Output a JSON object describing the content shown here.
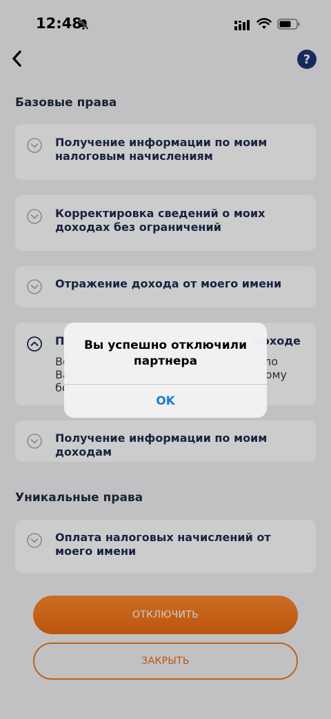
{
  "status_bar": {
    "time": "12:48"
  },
  "nav": {
    "help_label": "?"
  },
  "sections": {
    "basic": {
      "title": "Базовые права",
      "items": [
        {
          "title": "Получение информации по моим налоговым начислениям",
          "expanded": false
        },
        {
          "title": "Корректировка сведений о моих доходах без ограничений",
          "expanded": false
        },
        {
          "title": "Отражение дохода от моего имени",
          "expanded": false
        },
        {
          "title": "П… доходе",
          "desc": "Вс… Ва… бо…",
          "title_left": "П",
          "title_right": "доходе",
          "desc_line1_left": "Вс",
          "desc_line1_right": "ло",
          "desc_line2_left": "Ва",
          "desc_line2_right": "ому",
          "desc_line3_left": "бо",
          "expanded": true
        },
        {
          "title": "Получение информации по моим доходам",
          "expanded": false
        }
      ]
    },
    "unique": {
      "title": "Уникальные права",
      "items": [
        {
          "title": "Оплата налоговых начислений от моего имени",
          "expanded": false
        }
      ]
    }
  },
  "buttons": {
    "disconnect": "ОТКЛЮЧИТЬ",
    "close": "ЗАКРЫТЬ"
  },
  "alert": {
    "title": "Вы успешно отключили партнера",
    "ok": "OK"
  },
  "colors": {
    "accent": "#ec6a12",
    "primary_text": "#1d2b4f",
    "help_bg": "#1d3575",
    "link_blue": "#1a7bd8"
  }
}
